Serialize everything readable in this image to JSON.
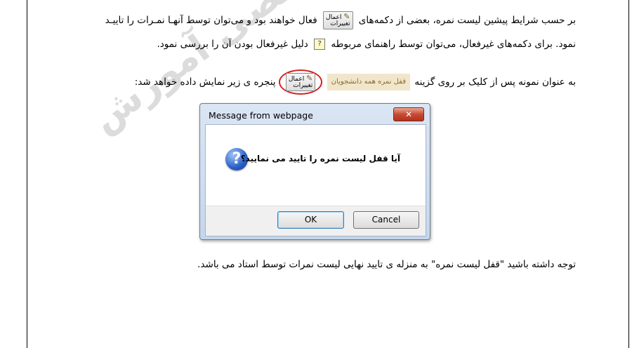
{
  "document": {
    "para1_line1_part1": "بر حسب شرایط پیشین لیست نمره، بعضی از دکمه‌های",
    "para1_line1_part2": "فعال خواهند بود و می‌توان توسط آنهـا نمـرات را تاییـد",
    "para1_line2_part1": "نمود. برای دکمه‌های غیرفعال، می‌توان توسط راهنمای مربوطه",
    "para1_line2_part2": "دلیل غیرفعال بودن آن را بررسی نمود.",
    "para2_part1": "به عنوان نمونه پس از کلیک بر روی گزینه",
    "para2_part2": "پنجره ی زیر نمایش داده خواهد شد:",
    "para3": "توجه داشته باشید \"قفل لیست نمره\" به منزله ی تایید نهایی لیست نمرات توسط استاد می باشد.",
    "button_label_line1": "اعمال",
    "button_label_line2": "تغییرات",
    "lock_option_label": "قفل نمره همه دانشجویان",
    "help_icon_glyph": "?"
  },
  "watermark": {
    "text": "تخصصی آموزش",
    "color": "#d6d6d6"
  },
  "dialog": {
    "title": "Message from webpage",
    "close_glyph": "✕",
    "message": "آیا قفل لیست نمره را تایید می نمایید؟",
    "ok_label": "OK",
    "cancel_label": "Cancel",
    "icon": "question-icon"
  },
  "colors": {
    "dialog_frame": "#c5d6ec",
    "close_button": "#c74a33",
    "highlight_circle": "#d62020"
  }
}
